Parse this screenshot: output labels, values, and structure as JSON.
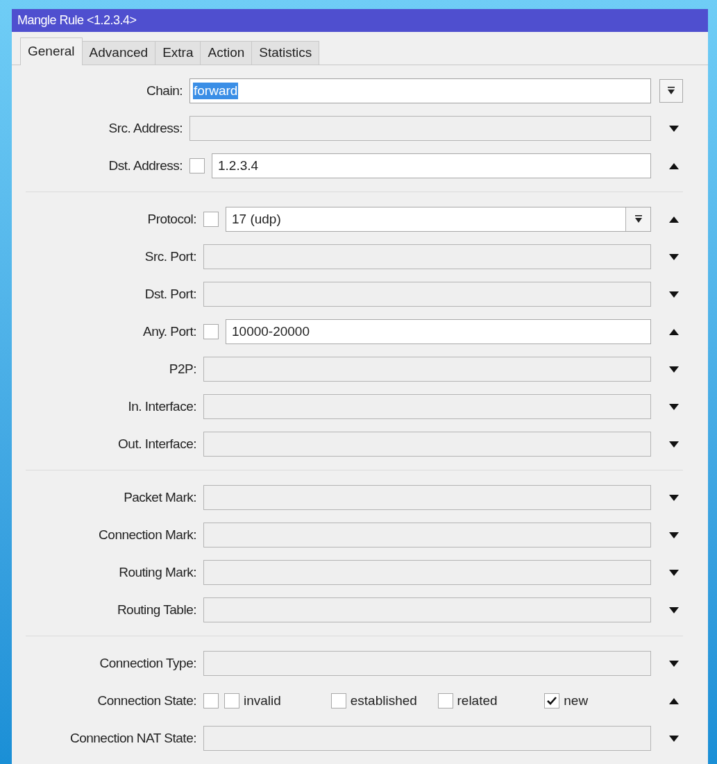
{
  "window": {
    "title": "Mangle Rule <1.2.3.4>"
  },
  "tabs": [
    {
      "label": "General",
      "selected": true
    },
    {
      "label": "Advanced",
      "selected": false
    },
    {
      "label": "Extra",
      "selected": false
    },
    {
      "label": "Action",
      "selected": false
    },
    {
      "label": "Statistics",
      "selected": false
    }
  ],
  "groups": [
    {
      "rows": [
        {
          "kind": "select",
          "label": "Chain:",
          "value": "forward",
          "value_selected": true
        },
        {
          "kind": "unset",
          "label": "Src. Address:",
          "expanded": false
        },
        {
          "kind": "value",
          "label": "Dst. Address:",
          "negate": false,
          "value": "1.2.3.4",
          "expanded": true
        }
      ]
    },
    {
      "rows": [
        {
          "kind": "value_select",
          "label": "Protocol:",
          "negate": false,
          "value": "17 (udp)",
          "expanded": true
        },
        {
          "kind": "unset",
          "label": "Src. Port:",
          "expanded": false
        },
        {
          "kind": "unset",
          "label": "Dst. Port:",
          "expanded": false
        },
        {
          "kind": "value",
          "label": "Any. Port:",
          "negate": false,
          "value": "10000-20000",
          "expanded": true
        },
        {
          "kind": "unset",
          "label": "P2P:",
          "expanded": false
        },
        {
          "kind": "unset",
          "label": "In. Interface:",
          "expanded": false
        },
        {
          "kind": "unset",
          "label": "Out. Interface:",
          "expanded": false
        }
      ]
    },
    {
      "rows": [
        {
          "kind": "unset",
          "label": "Packet Mark:",
          "expanded": false
        },
        {
          "kind": "unset",
          "label": "Connection Mark:",
          "expanded": false
        },
        {
          "kind": "unset",
          "label": "Routing Mark:",
          "expanded": false
        },
        {
          "kind": "unset",
          "label": "Routing Table:",
          "expanded": false
        }
      ]
    },
    {
      "rows": [
        {
          "kind": "unset",
          "label": "Connection Type:",
          "expanded": false
        },
        {
          "kind": "states",
          "label": "Connection State:",
          "negate": false,
          "expanded": true,
          "options": [
            {
              "label": "invalid",
              "checked": false
            },
            {
              "label": "established",
              "checked": false
            },
            {
              "label": "related",
              "checked": false
            },
            {
              "label": "new",
              "checked": true
            }
          ]
        },
        {
          "kind": "unset",
          "label": "Connection NAT State:",
          "expanded": false
        }
      ]
    }
  ]
}
